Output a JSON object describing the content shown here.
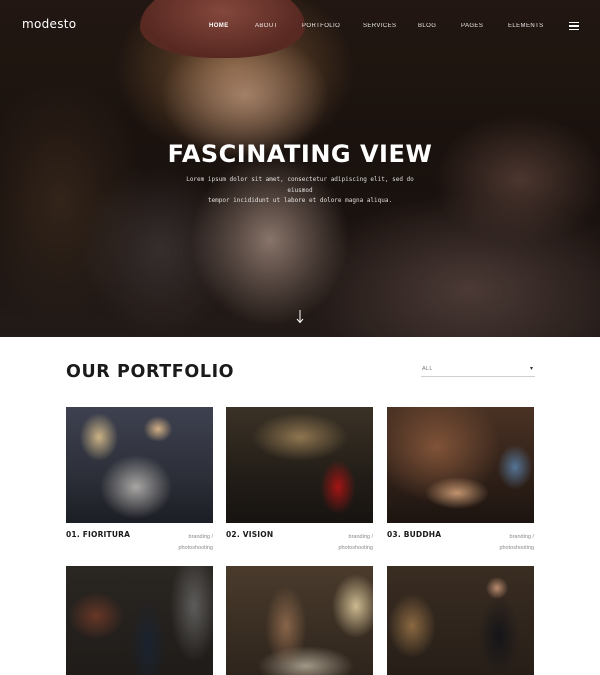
{
  "brand": {
    "logo_text": "modesto"
  },
  "nav": {
    "items": [
      {
        "label": "HOME",
        "active": true
      },
      {
        "label": "ABOUT",
        "active": false
      },
      {
        "label": "PORTFOLIO",
        "active": false
      },
      {
        "label": "SERVICES",
        "active": false
      },
      {
        "label": "BLOG",
        "active": false
      },
      {
        "label": "PAGES",
        "active": false
      },
      {
        "label": "ELEMENTS",
        "active": false
      }
    ],
    "menu_icon": "hamburger-icon"
  },
  "hero": {
    "title": "FASCINATING VIEW",
    "subtitle_line1": "Lorem ipsum dolor sit amet, consectetur adipiscing elit, sed do eiusmod",
    "subtitle_line2": "tempor incididunt ut labore et dolore magna aliqua.",
    "scroll_icon": "arrow-down-icon"
  },
  "portfolio": {
    "title": "OUR PORTFOLIO",
    "filter": {
      "selected": "ALL",
      "caret_icon": "caret-down-icon"
    },
    "items": [
      {
        "title": "01. FIORITURA",
        "tag1": "branding /",
        "tag2": "photoshooting"
      },
      {
        "title": "02. VISION",
        "tag1": "branding /",
        "tag2": "photoshooting"
      },
      {
        "title": "03. BUDDHA",
        "tag1": "branding /",
        "tag2": "photoshooting"
      },
      {
        "title": "",
        "tag1": "",
        "tag2": ""
      },
      {
        "title": "",
        "tag1": "",
        "tag2": ""
      },
      {
        "title": "",
        "tag1": "",
        "tag2": ""
      }
    ]
  },
  "colors": {
    "text_dark": "#1a1a1a",
    "muted": "#8a8a8a",
    "hero_overlay": "#1e1511"
  }
}
